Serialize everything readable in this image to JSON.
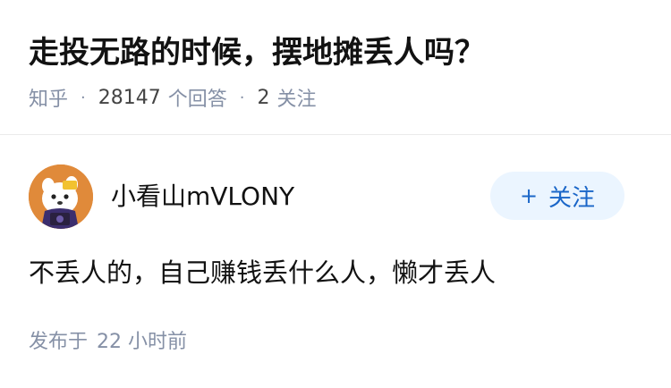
{
  "question": {
    "title": "走投无路的时候，摆地摊丢人吗？",
    "source": "知乎",
    "separator": "·",
    "answer_count": "28147",
    "answer_label": "个回答",
    "follower_count": "2",
    "follower_label": "关注"
  },
  "answer": {
    "author": {
      "name": "小看山mVLONY",
      "avatar_icon": "avatar-cartoon-mascot"
    },
    "follow_button": {
      "icon": "plus-icon",
      "label": "关注"
    },
    "content": "不丢人的，自己赚钱丢什么人，懒才丢人",
    "published_label": "发布于",
    "published_time": "22 小时前"
  },
  "colors": {
    "title": "#121212",
    "meta": "#8590a6",
    "follow_bg": "#ebf5ff",
    "follow_text": "#1a66c8",
    "avatar_bg": "#e08a3a",
    "divider": "#ebebeb"
  }
}
